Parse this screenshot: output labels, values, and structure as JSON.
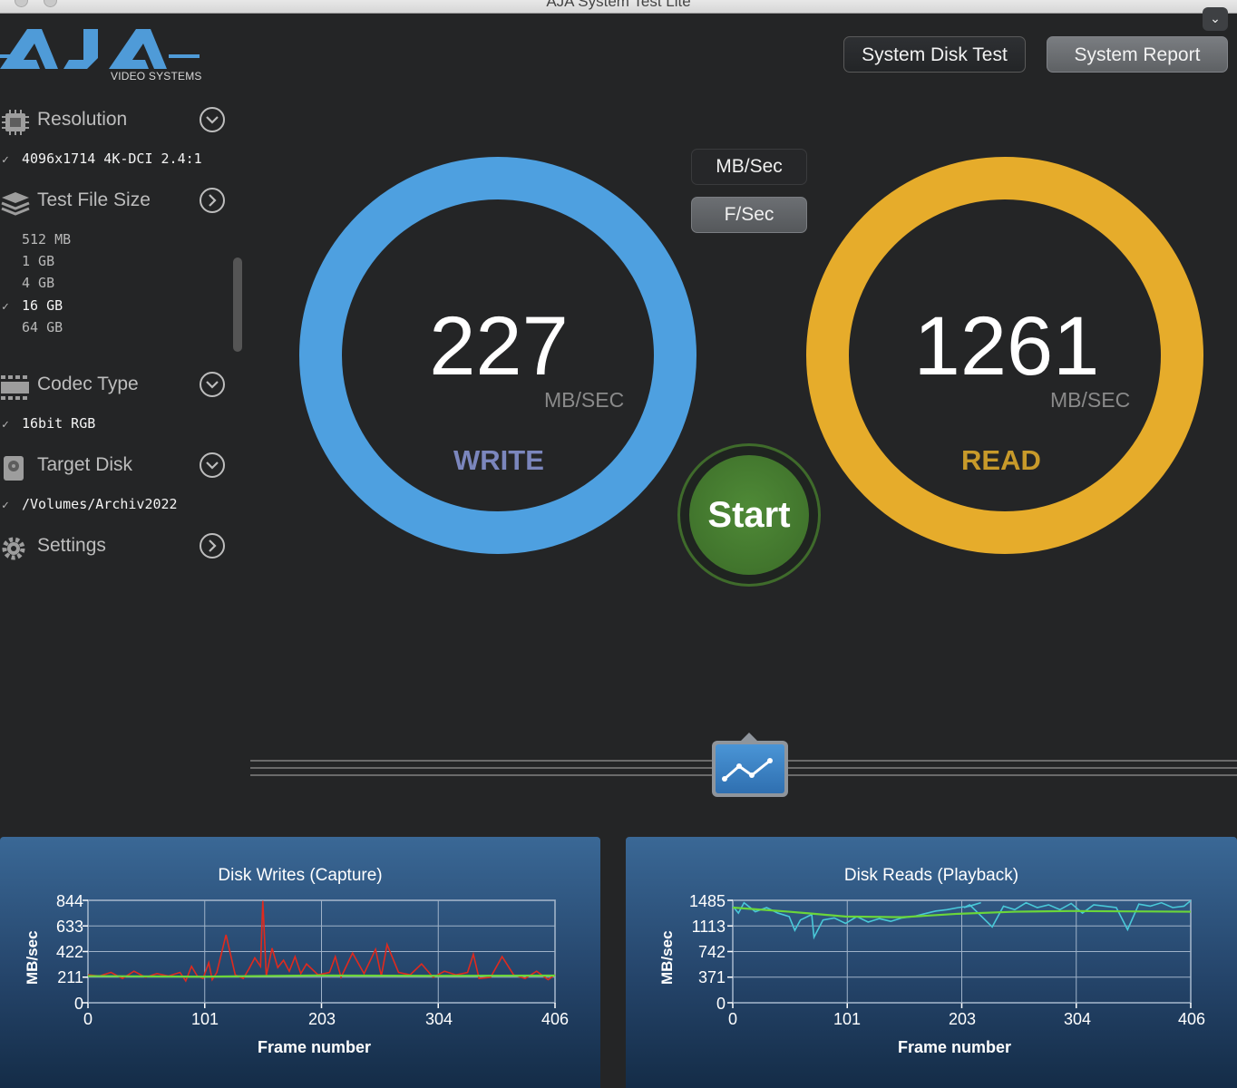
{
  "window": {
    "title": "AJA System Test Lite"
  },
  "logo": {
    "subtitle": "VIDEO SYSTEMS"
  },
  "header": {
    "system_disk_test_label": "System Disk Test",
    "system_report_label": "System Report"
  },
  "sidebar": {
    "resolution": {
      "label": "Resolution",
      "selected": "4096x1714 4K-DCI 2.4:1"
    },
    "test_file_size": {
      "label": "Test File Size",
      "options": [
        {
          "label": "512 MB",
          "selected": false
        },
        {
          "label": "1 GB",
          "selected": false
        },
        {
          "label": "4 GB",
          "selected": false
        },
        {
          "label": "16 GB",
          "selected": true
        },
        {
          "label": "64 GB",
          "selected": false
        }
      ],
      "check": "✓"
    },
    "codec_type": {
      "label": "Codec Type",
      "selected": "16bit RGB"
    },
    "target_disk": {
      "label": "Target Disk",
      "selected": "/Volumes/Archiv2022"
    },
    "settings": {
      "label": "Settings"
    },
    "check": "✓"
  },
  "units": {
    "mb_sec_label": "MB/Sec",
    "f_sec_label": "F/Sec"
  },
  "write_gauge": {
    "value": "227",
    "unit": "MB/SEC",
    "label": "WRITE",
    "color": "#4ea0e0",
    "label_color": "#7b86bd"
  },
  "read_gauge": {
    "value": "1261",
    "unit": "MB/SEC",
    "label": "READ",
    "color": "#e6ac2b",
    "label_color": "#c89a2a"
  },
  "start_button": {
    "label": "Start"
  },
  "chart_data": [
    {
      "type": "line",
      "title": "Disk Writes (Capture)",
      "xlabel": "Frame number",
      "ylabel": "MB/sec",
      "xlim": [
        0,
        406
      ],
      "ylim": [
        0,
        844
      ],
      "x_ticks": [
        "0",
        "101",
        "203",
        "304",
        "406"
      ],
      "y_ticks": [
        "844",
        "633",
        "422",
        "211",
        "0"
      ],
      "series": [
        {
          "color": "#e02a1e",
          "x": [
            0,
            10,
            20,
            30,
            40,
            50,
            60,
            70,
            80,
            85,
            90,
            95,
            100,
            105,
            108,
            112,
            120,
            128,
            135,
            140,
            145,
            150,
            152,
            155,
            160,
            165,
            170,
            175,
            180,
            185,
            190,
            200,
            210,
            215,
            220,
            230,
            240,
            250,
            255,
            260,
            270,
            280,
            290,
            300,
            310,
            320,
            330,
            335,
            340,
            350,
            360,
            370,
            380,
            390,
            400,
            406
          ],
          "values": [
            230,
            220,
            250,
            200,
            260,
            210,
            240,
            220,
            250,
            180,
            300,
            220,
            200,
            330,
            190,
            250,
            560,
            230,
            200,
            280,
            370,
            300,
            840,
            220,
            450,
            290,
            350,
            260,
            380,
            240,
            320,
            230,
            250,
            380,
            210,
            410,
            240,
            440,
            220,
            480,
            250,
            230,
            320,
            210,
            260,
            230,
            250,
            400,
            200,
            210,
            380,
            230,
            200,
            260,
            190,
            230
          ]
        },
        {
          "color": "#6bd63a",
          "x": [
            0,
            100,
            200,
            300,
            406
          ],
          "values": [
            220,
            215,
            225,
            222,
            224
          ]
        }
      ]
    },
    {
      "type": "line",
      "title": "Disk Reads (Playback)",
      "xlabel": "Frame number",
      "ylabel": "MB/sec",
      "xlim": [
        0,
        406
      ],
      "ylim": [
        0,
        1485
      ],
      "x_ticks": [
        "0",
        "101",
        "203",
        "304",
        "406"
      ],
      "y_ticks": [
        "1485",
        "1113",
        "742",
        "371",
        "0"
      ],
      "series": [
        {
          "color": "#49c8d8",
          "x": [
            0,
            5,
            10,
            20,
            30,
            40,
            50,
            55,
            60,
            70,
            72,
            80,
            90,
            100,
            110,
            120,
            130,
            140,
            150,
            160,
            170,
            180,
            190,
            200,
            210,
            220,
            205,
            210,
            230,
            240,
            250,
            260,
            270,
            280,
            290,
            300,
            310,
            320,
            330,
            340,
            350,
            360,
            370,
            380,
            390,
            400,
            406
          ],
          "values": [
            1400,
            1300,
            1450,
            1320,
            1380,
            1300,
            1250,
            1050,
            1200,
            1280,
            950,
            1200,
            1230,
            1150,
            1250,
            1170,
            1220,
            1180,
            1230,
            1250,
            1290,
            1330,
            1350,
            1380,
            1400,
            1450,
            1380,
            1420,
            1100,
            1400,
            1350,
            1450,
            1380,
            1420,
            1350,
            1440,
            1300,
            1420,
            1400,
            1380,
            1060,
            1430,
            1400,
            1450,
            1380,
            1400,
            1480
          ]
        },
        {
          "color": "#6bd63a",
          "x": [
            0,
            50,
            100,
            150,
            200,
            250,
            300,
            350,
            406
          ],
          "values": [
            1380,
            1320,
            1250,
            1240,
            1290,
            1320,
            1330,
            1325,
            1320
          ]
        }
      ]
    }
  ]
}
